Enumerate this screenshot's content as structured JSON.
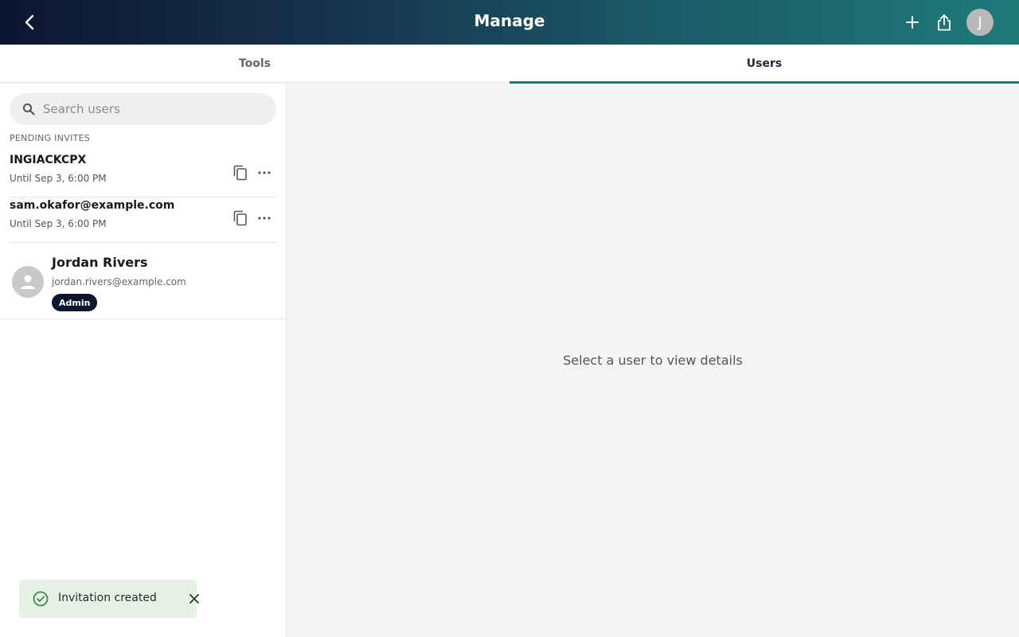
{
  "header": {
    "title": "Manage",
    "avatar_initial": "J",
    "icons": {
      "back": "chevron-left-icon",
      "add": "plus-icon",
      "share": "share-icon"
    }
  },
  "tabs": [
    {
      "label": "Tools",
      "active": false
    },
    {
      "label": "Users",
      "active": true
    }
  ],
  "sidebar": {
    "search": {
      "placeholder": "Search users",
      "value": ""
    },
    "section_label": "PENDING INVITES",
    "invites": [
      {
        "code": "INGIACKCPX",
        "until": "Until Sep 3, 6:00 PM"
      },
      {
        "code": "sam.okafor@example.com",
        "until": "Until Sep 3, 6:00 PM"
      }
    ],
    "users": [
      {
        "name": "Jordan Rivers",
        "email": "jordan.rivers@example.com",
        "role": "Admin"
      }
    ]
  },
  "main": {
    "empty_text": "Select a user to view details"
  },
  "toast": {
    "message": "Invitation created",
    "status_color": "#3b8a3e"
  },
  "colors": {
    "accent": "#1f7a78",
    "badge": "#0f1730"
  }
}
